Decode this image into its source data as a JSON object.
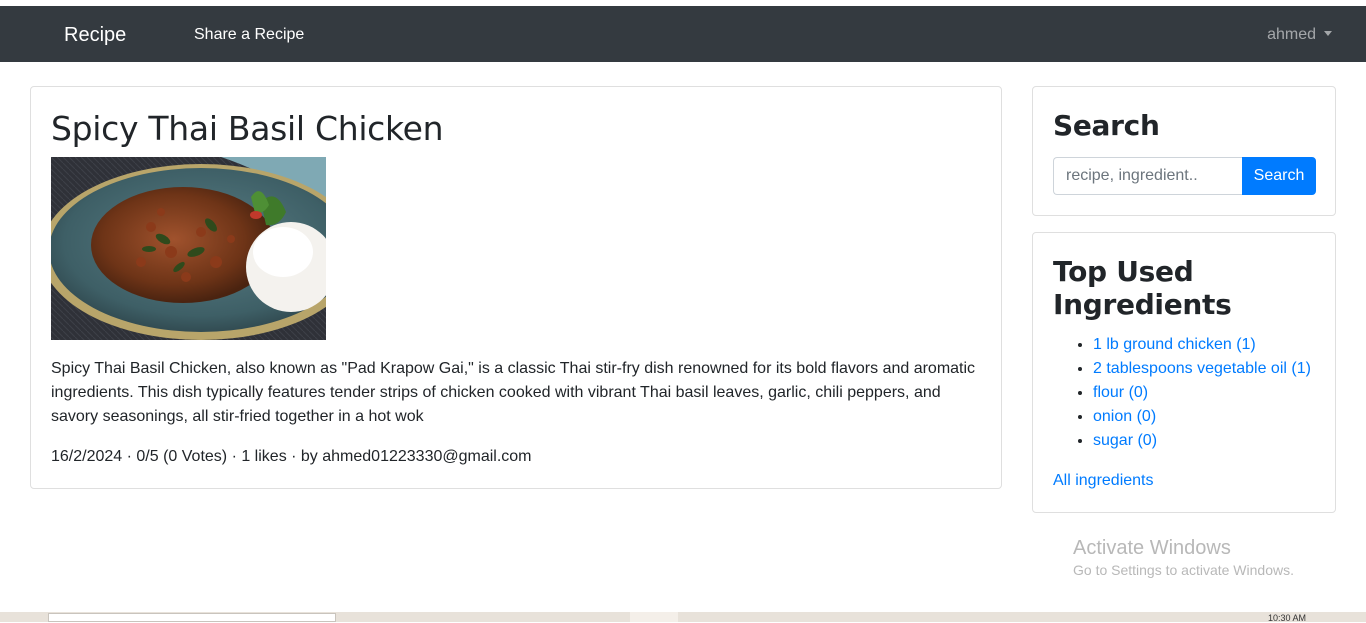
{
  "navbar": {
    "brand": "Recipe",
    "share_link": "Share a Recipe",
    "user": "ahmed"
  },
  "recipe": {
    "title": "Spicy Thai Basil Chicken",
    "image_alt": "Spicy Thai Basil Chicken",
    "description": "Spicy Thai Basil Chicken, also known as \"Pad Krapow Gai,\" is a classic Thai stir-fry dish renowned for its bold flavors and aromatic ingredients. This dish typically features tender strips of chicken cooked with vibrant Thai basil leaves, garlic, chili peppers, and savory seasonings, all stir-fried together in a hot wok",
    "meta": "16/2/2024 · 0/5 (0 Votes) · 1 likes · by ahmed01223330@gmail.com"
  },
  "search": {
    "title": "Search",
    "placeholder": "recipe, ingredient..",
    "button_label": "Search"
  },
  "ingredients": {
    "title_line1": "Top Used",
    "title_line2": "Ingredients",
    "items": [
      {
        "label": "1 lb ground chicken (1)"
      },
      {
        "label": "2 tablespoons vegetable oil (1)"
      },
      {
        "label": "flour (0)"
      },
      {
        "label": "onion (0)"
      },
      {
        "label": "sugar (0)"
      }
    ],
    "all_link": "All ingredients"
  },
  "watermark": {
    "title": "Activate Windows",
    "subtitle": "Go to Settings to activate Windows."
  },
  "taskbar": {
    "clock": "10:30 AM"
  },
  "colors": {
    "navbar": "#343a40",
    "primary": "#007bff"
  }
}
